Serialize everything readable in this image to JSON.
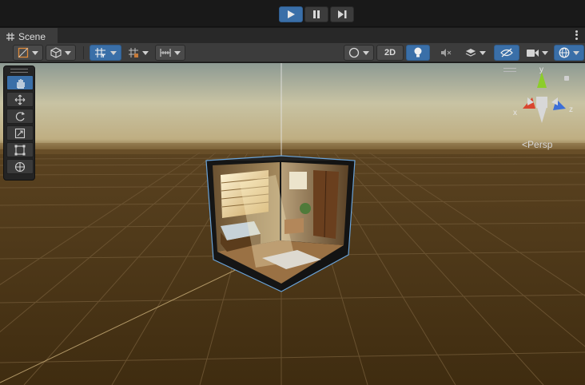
{
  "playbar": {
    "buttons": [
      {
        "icon": "play-icon",
        "active": true
      },
      {
        "icon": "pause-icon",
        "active": false
      },
      {
        "icon": "step-icon",
        "active": false
      }
    ]
  },
  "tab": {
    "icon": "grid-icon",
    "label": "Scene"
  },
  "toolbar": {
    "left_tools": [
      "draw-mode-icon",
      "shading-cube-icon",
      "grid-snap-icon",
      "snap-increment-icon",
      "ruler-icon"
    ],
    "mode_2d_label": "2D",
    "right_tools": [
      "shading-sphere-icon",
      "lighting-bulb-icon",
      "audio-mute-icon",
      "effects-layers-icon",
      "scene-visibility-icon",
      "camera-icon",
      "gizmos-globe-icon"
    ]
  },
  "palette": {
    "tools": [
      {
        "name": "hand-tool",
        "active": true
      },
      {
        "name": "move-tool",
        "active": false
      },
      {
        "name": "rotate-tool",
        "active": false
      },
      {
        "name": "scale-tool",
        "active": false
      },
      {
        "name": "rect-tool",
        "active": false
      },
      {
        "name": "transform-tool",
        "active": false
      }
    ]
  },
  "gizmo": {
    "y_label": "y",
    "x_label": "x",
    "z_label": "z",
    "projection_label": "Persp",
    "colors": {
      "x": "#d9452f",
      "y": "#8ccd2a",
      "z": "#3c6fd8"
    }
  },
  "colors": {
    "accent": "#3a6fa8",
    "ground": "#4a3414",
    "sky": "#cfc7a8"
  }
}
